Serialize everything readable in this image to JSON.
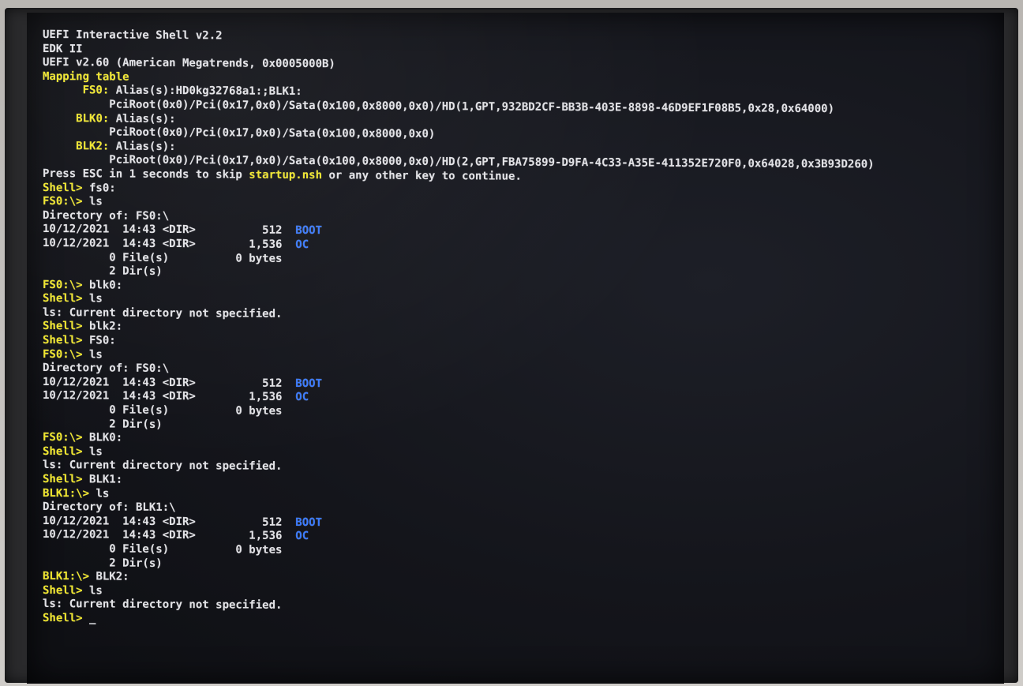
{
  "title": "UEFI Interactive Shell v2.2",
  "colors": {
    "background": "#14151b",
    "text": "#e2e2e6",
    "highlight": "#f0e62c",
    "dir_name": "#3b7bff"
  },
  "lines": [
    {
      "indent": "",
      "parts": [
        {
          "text": "UEFI Interactive Shell v2.2",
          "color": "w"
        }
      ]
    },
    {
      "indent": "",
      "parts": [
        {
          "text": "EDK II",
          "color": "w"
        }
      ]
    },
    {
      "indent": "",
      "parts": [
        {
          "text": "UEFI v2.60 (American Megatrends, 0x0005000B)",
          "color": "w"
        }
      ]
    },
    {
      "indent": "",
      "parts": [
        {
          "text": "Mapping table",
          "color": "y"
        }
      ]
    },
    {
      "indent": "      ",
      "parts": [
        {
          "text": "FS0:",
          "color": "y"
        },
        {
          "text": " Alias(s):HD0kg32768a1:;BLK1:",
          "color": "w"
        }
      ]
    },
    {
      "indent": "          ",
      "parts": [
        {
          "text": "PciRoot(0x0)/Pci(0x17,0x0)/Sata(0x100,0x8000,0x0)/HD(1,GPT,932BD2CF-BB3B-403E-8898-46D9EF1F08B5,0x28,0x64000)",
          "color": "w"
        }
      ]
    },
    {
      "indent": "     ",
      "parts": [
        {
          "text": "BLK0:",
          "color": "y"
        },
        {
          "text": " Alias(s):",
          "color": "w"
        }
      ]
    },
    {
      "indent": "          ",
      "parts": [
        {
          "text": "PciRoot(0x0)/Pci(0x17,0x0)/Sata(0x100,0x8000,0x0)",
          "color": "w"
        }
      ]
    },
    {
      "indent": "     ",
      "parts": [
        {
          "text": "BLK2:",
          "color": "y"
        },
        {
          "text": " Alias(s):",
          "color": "w"
        }
      ]
    },
    {
      "indent": "          ",
      "parts": [
        {
          "text": "PciRoot(0x0)/Pci(0x17,0x0)/Sata(0x100,0x8000,0x0)/HD(2,GPT,FBA75899-D9FA-4C33-A35E-411352E720F0,0x64028,0x3B93D260)",
          "color": "w"
        }
      ]
    },
    {
      "indent": "",
      "parts": [
        {
          "text": "Press ESC in 1 seconds to skip ",
          "color": "w"
        },
        {
          "text": "startup.nsh",
          "color": "y"
        },
        {
          "text": " or any other key to continue.",
          "color": "w"
        }
      ]
    },
    {
      "indent": "",
      "parts": [
        {
          "text": "Shell>",
          "color": "y"
        },
        {
          "text": " fs0:",
          "color": "w"
        }
      ]
    },
    {
      "indent": "",
      "parts": [
        {
          "text": "FS0:\\>",
          "color": "y"
        },
        {
          "text": " ls",
          "color": "w"
        }
      ]
    },
    {
      "indent": "",
      "parts": [
        {
          "text": "Directory of: FS0:\\",
          "color": "w"
        }
      ]
    },
    {
      "indent": "",
      "parts": [
        {
          "text": "10/12/2021  14:43 <DIR>          512  ",
          "color": "w"
        },
        {
          "text": "BOOT",
          "color": "b"
        }
      ]
    },
    {
      "indent": "",
      "parts": [
        {
          "text": "10/12/2021  14:43 <DIR>        1,536  ",
          "color": "w"
        },
        {
          "text": "OC",
          "color": "b"
        }
      ]
    },
    {
      "indent": "",
      "parts": [
        {
          "text": "          0 File(s)          0 bytes",
          "color": "w"
        }
      ]
    },
    {
      "indent": "",
      "parts": [
        {
          "text": "          2 Dir(s)",
          "color": "w"
        }
      ]
    },
    {
      "indent": "",
      "parts": [
        {
          "text": "FS0:\\>",
          "color": "y"
        },
        {
          "text": " blk0:",
          "color": "w"
        }
      ]
    },
    {
      "indent": "",
      "parts": [
        {
          "text": "Shell>",
          "color": "y"
        },
        {
          "text": " ls",
          "color": "w"
        }
      ]
    },
    {
      "indent": "",
      "parts": [
        {
          "text": "ls: Current directory not specified.",
          "color": "w"
        }
      ]
    },
    {
      "indent": "",
      "parts": [
        {
          "text": "Shell>",
          "color": "y"
        },
        {
          "text": " blk2:",
          "color": "w"
        }
      ]
    },
    {
      "indent": "",
      "parts": [
        {
          "text": "Shell>",
          "color": "y"
        },
        {
          "text": " FS0:",
          "color": "w"
        }
      ]
    },
    {
      "indent": "",
      "parts": [
        {
          "text": "FS0:\\>",
          "color": "y"
        },
        {
          "text": " ls",
          "color": "w"
        }
      ]
    },
    {
      "indent": "",
      "parts": [
        {
          "text": "Directory of: FS0:\\",
          "color": "w"
        }
      ]
    },
    {
      "indent": "",
      "parts": [
        {
          "text": "10/12/2021  14:43 <DIR>          512  ",
          "color": "w"
        },
        {
          "text": "BOOT",
          "color": "b"
        }
      ]
    },
    {
      "indent": "",
      "parts": [
        {
          "text": "10/12/2021  14:43 <DIR>        1,536  ",
          "color": "w"
        },
        {
          "text": "OC",
          "color": "b"
        }
      ]
    },
    {
      "indent": "",
      "parts": [
        {
          "text": "          0 File(s)          0 bytes",
          "color": "w"
        }
      ]
    },
    {
      "indent": "",
      "parts": [
        {
          "text": "          2 Dir(s)",
          "color": "w"
        }
      ]
    },
    {
      "indent": "",
      "parts": [
        {
          "text": "FS0:\\>",
          "color": "y"
        },
        {
          "text": " BLK0:",
          "color": "w"
        }
      ]
    },
    {
      "indent": "",
      "parts": [
        {
          "text": "Shell>",
          "color": "y"
        },
        {
          "text": " ls",
          "color": "w"
        }
      ]
    },
    {
      "indent": "",
      "parts": [
        {
          "text": "ls: Current directory not specified.",
          "color": "w"
        }
      ]
    },
    {
      "indent": "",
      "parts": [
        {
          "text": "Shell>",
          "color": "y"
        },
        {
          "text": " BLK1:",
          "color": "w"
        }
      ]
    },
    {
      "indent": "",
      "parts": [
        {
          "text": "BLK1:\\>",
          "color": "y"
        },
        {
          "text": " ls",
          "color": "w"
        }
      ]
    },
    {
      "indent": "",
      "parts": [
        {
          "text": "Directory of: BLK1:\\",
          "color": "w"
        }
      ]
    },
    {
      "indent": "",
      "parts": [
        {
          "text": "10/12/2021  14:43 <DIR>          512  ",
          "color": "w"
        },
        {
          "text": "BOOT",
          "color": "b"
        }
      ]
    },
    {
      "indent": "",
      "parts": [
        {
          "text": "10/12/2021  14:43 <DIR>        1,536  ",
          "color": "w"
        },
        {
          "text": "OC",
          "color": "b"
        }
      ]
    },
    {
      "indent": "",
      "parts": [
        {
          "text": "          0 File(s)          0 bytes",
          "color": "w"
        }
      ]
    },
    {
      "indent": "",
      "parts": [
        {
          "text": "          2 Dir(s)",
          "color": "w"
        }
      ]
    },
    {
      "indent": "",
      "parts": [
        {
          "text": "BLK1:\\>",
          "color": "y"
        },
        {
          "text": " BLK2:",
          "color": "w"
        }
      ]
    },
    {
      "indent": "",
      "parts": [
        {
          "text": "Shell>",
          "color": "y"
        },
        {
          "text": " ls",
          "color": "w"
        }
      ]
    },
    {
      "indent": "",
      "parts": [
        {
          "text": "ls: Current directory not specified.",
          "color": "w"
        }
      ]
    },
    {
      "indent": "",
      "parts": [
        {
          "text": "Shell>",
          "color": "y"
        },
        {
          "text": " _",
          "color": "w"
        }
      ]
    }
  ]
}
